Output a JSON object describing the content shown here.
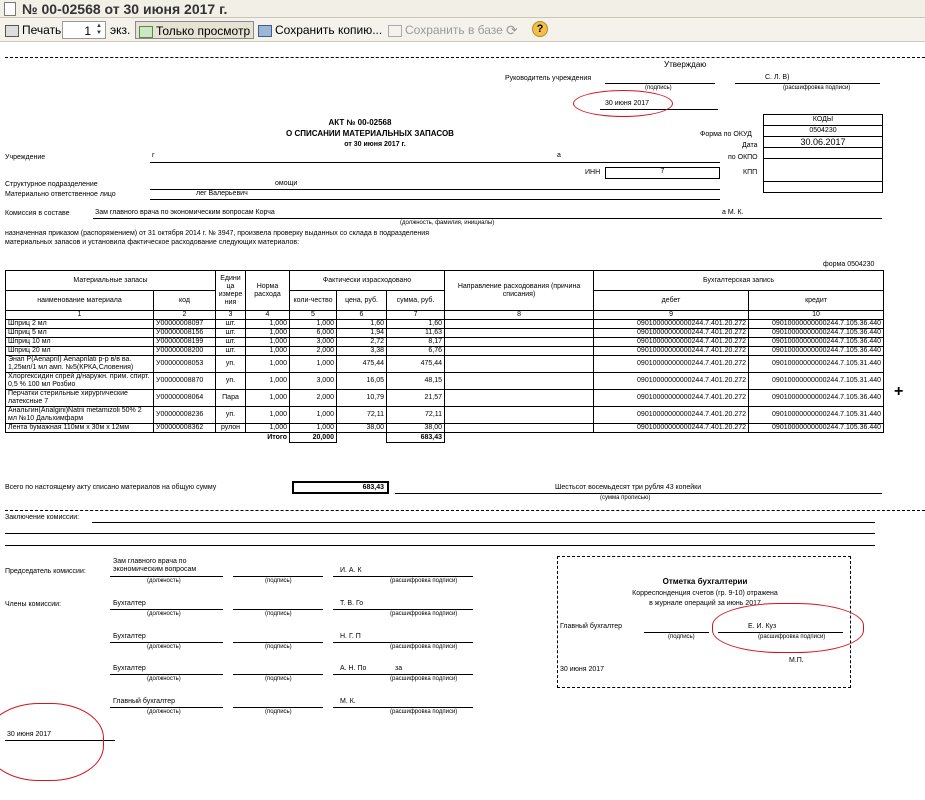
{
  "window": {
    "title": "№ 00-02568 от 30 июня 2017 г."
  },
  "toolbar": {
    "print": "Печать",
    "copies": "1",
    "copies_unit": "экз.",
    "view_only": "Только просмотр",
    "save_copy": "Сохранить копию...",
    "save_db": "Сохранить в базе"
  },
  "doc": {
    "approve": "Утверждаю",
    "head_label": "Руководитель учреждения",
    "head_name": "С. Л. В)",
    "sign_label": "(подпись)",
    "sign_decode_label": "(расшифровка подписи)",
    "approve_date": "30 июня 2017",
    "title_line1": "АКТ № 00-02568",
    "title_line2": "О СПИСАНИИ МАТЕРИАЛЬНЫХ ЗАПАСОВ",
    "title_date": "от 30 июня 2017 г.",
    "codes_header": "КОДЫ",
    "form_okud_label": "Форма  по ОКУД",
    "form_okud": "0504230",
    "date_label": "Дата",
    "date_value": "30.06.2017",
    "okpo_label": "по ОКПО",
    "kpp_label": "КПП",
    "kpp_value": "",
    "inn_label": "ИНН",
    "inn_value": "7",
    "inst_label": "Учреждение",
    "inst_value": "г",
    "inst_tail": "а",
    "subdiv_label": "Структурное подразделение",
    "subdiv_value": "омощи",
    "resp_label": "Материально ответственное лицо",
    "resp_value": "лег Валерьевич",
    "commission_label": "Комиссия в составе",
    "commission_value": "Зам главного врача по экономическим вопросам Корча",
    "commission_tail": "а М. К.",
    "commission_hint": "(должность, фамилия, инициалы)",
    "order_text1": "назначенная приказом (распоряжением)  от  31 октября 2014 г. №  3947, произвела проверку выданных со склада в подразделения",
    "order_text2": "материальных запасов и установила фактическое расходование следующих материалов:",
    "form_label": "форма 0504230",
    "table": {
      "h_materials": "Материальные запасы",
      "h_unit": "Едини ца измере ния",
      "h_norm": "Норма расхода",
      "h_actual": "Фактически израсходовано",
      "h_direction": "Направление расходования (причина списания)",
      "h_accounting": "Бухгалтерская запись",
      "h_name": "наименование материала",
      "h_code": "код",
      "h_qty": "коли-чество",
      "h_price": "цена, руб.",
      "h_sum": "сумма, руб.",
      "h_debit": "дебет",
      "h_credit": "кредит",
      "nums": [
        "1",
        "2",
        "3",
        "4",
        "5",
        "6",
        "7",
        "8",
        "9",
        "10"
      ],
      "rows": [
        {
          "name": "Шприц 2 мл",
          "code": "У00000008097",
          "unit": "шт.",
          "norm": "1,000",
          "qty": "1,000",
          "price": "1,60",
          "sum": "1,60",
          "dir": "",
          "debit": "09010000000000244.7.401.20.272",
          "credit": "09010000000000244.7.105.36.440"
        },
        {
          "name": "Шприц 5 мл",
          "code": "У00000008156",
          "unit": "шт.",
          "norm": "1,000",
          "qty": "6,000",
          "price": "1,94",
          "sum": "11,63",
          "dir": "",
          "debit": "09010000000000244.7.401.20.272",
          "credit": "09010000000000244.7.105.36.440"
        },
        {
          "name": "Шприц 10 мл",
          "code": "У00000008199",
          "unit": "шт.",
          "norm": "1,000",
          "qty": "3,000",
          "price": "2,72",
          "sum": "8,17",
          "dir": "",
          "debit": "09010000000000244.7.401.20.272",
          "credit": "09010000000000244.7.105.36.440"
        },
        {
          "name": "Шприц 20 мл",
          "code": "У00000008200",
          "unit": "шт.",
          "norm": "1,000",
          "qty": "2,000",
          "price": "3,38",
          "sum": "6,76",
          "dir": "",
          "debit": "09010000000000244.7.401.20.272",
          "credit": "09010000000000244.7.105.36.440"
        },
        {
          "name": "Энап Р(Aenapril) Aenaprilati р-р в/в ва. 1,25мл/1 мл амп. №5(КРКА,Словения)",
          "code": "У00000008053",
          "unit": "уп.",
          "norm": "1,000",
          "qty": "1,000",
          "price": "475,44",
          "sum": "475,44",
          "dir": "",
          "debit": "09010000000000244.7.401.20.272",
          "credit": "09010000000000244.7.105.31.440"
        },
        {
          "name": "Хлоргексидин спрей д/наружн. прим. спирт. 0,5 % 100 мл Розбио",
          "code": "У00000008870",
          "unit": "уп.",
          "norm": "1,000",
          "qty": "3,000",
          "price": "16,05",
          "sum": "48,15",
          "dir": "",
          "debit": "09010000000000244.7.401.20.272",
          "credit": "09010000000000244.7.105.31.440"
        },
        {
          "name": "Перчатки стерильные хирургические латексные 7",
          "code": "У00000008064",
          "unit": "Пара",
          "norm": "1,000",
          "qty": "2,000",
          "price": "10,79",
          "sum": "21,57",
          "dir": "",
          "debit": "09010000000000244.7.401.20.272",
          "credit": "09010000000000244.7.105.36.440"
        },
        {
          "name": "Анальгин(Analgini)Natrii metamizoli 50% 2 мл №10 Дальхимфарм",
          "code": "У00000008236",
          "unit": "уп.",
          "norm": "1,000",
          "qty": "1,000",
          "price": "72,11",
          "sum": "72,11",
          "dir": "",
          "debit": "09010000000000244.7.401.20.272",
          "credit": "09010000000000244.7.105.31.440"
        },
        {
          "name": "Лента бумажная 110мм х 30м х 12мм",
          "code": "У00000008362",
          "unit": "рулон",
          "norm": "1,000",
          "qty": "1,000",
          "price": "38,00",
          "sum": "38,00",
          "dir": "",
          "debit": "09010000000000244.7.401.20.272",
          "credit": "09010000000000244.7.105.36.440"
        }
      ],
      "total_label": "Итого",
      "total_qty": "20,000",
      "total_sum": "683,43"
    },
    "total_text": "Всего по настоящему акту списано материалов на общую сумму",
    "total_value": "683,43",
    "total_words": "Шестьсот восемьдесят три рубля 43 копейки",
    "words_hint": "(сумма прописью)",
    "conclusion": "Заключение комиссии:",
    "chair_label": "Председатель комиссии:",
    "chair_pos": "Зам главного врача по экономическим вопросам",
    "chair_name": "И. А. К",
    "members_label": "Члены комиссии:",
    "pos_hint": "(должность)",
    "m1_pos": "Бухгалтер",
    "m1_name": "Т. В. Го",
    "m2_pos": "Бухгалтер",
    "m2_name": "Н. Г. П",
    "m3_pos": "Бухгалтер",
    "m3_name": "А. Н. По",
    "m3_tail": "за",
    "m4_pos": "Главный бухгалтер",
    "m4_name": "М. К.",
    "bottom_date": "30 июня 2017",
    "acc_title": "Отметка бухгалтерии",
    "acc_line1": "Корреспонденция счетов (гр. 9-10) отражена",
    "acc_line2": "в журнале операций за июнь 2017",
    "acc_chief": "Главный бухгалтер",
    "acc_name": "Е. И. Куз",
    "acc_mp": "М.П.",
    "acc_date": "30 июня 2017"
  }
}
